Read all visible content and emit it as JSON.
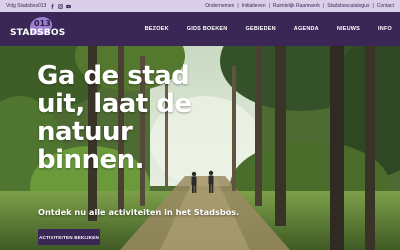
{
  "topbar": {
    "follow_text": "Volg Stadsbos013",
    "social_icons": [
      "facebook-icon",
      "instagram-icon",
      "youtube-icon"
    ],
    "links": [
      "Ondernemen",
      "Initiatieven",
      "Ruimtelijk Raamwerk",
      "Stadsboscatalogus",
      "Contact"
    ]
  },
  "logo": {
    "number": "013",
    "wordmark": "STADSBOS"
  },
  "nav": {
    "items": [
      "BEZOEK",
      "GIDS BOEKEN",
      "GEBIEDEN",
      "AGENDA",
      "NIEUWS",
      "INFO"
    ]
  },
  "hero": {
    "headline_lines": [
      "Ga de stad",
      "uit, laat de",
      "natuur",
      "binnen."
    ],
    "subheading": "Ontdek nu alle activiteiten in het Stadsbos.",
    "cta_label": "ACTIVITEITEN BEKIJKEN"
  },
  "colors": {
    "topbar_bg": "#d9cfe8",
    "nav_bg": "#3a2756",
    "logo_accent": "#9c7fd0",
    "cta_bg": "#3a2756"
  }
}
